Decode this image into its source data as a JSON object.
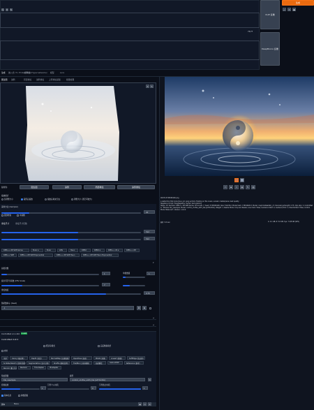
{
  "top": {
    "generate_label": "生成",
    "clip_interrogate_label": "CLIP 反推",
    "deepbooru_label": "DeepBooru 反推",
    "prompt_tokens": "75/75",
    "prompt_text": "",
    "negative_text": ""
  },
  "tabs": {
    "labels": [
      "生成",
      "嵌入式 (T.I. Embedding)",
      "超网络 (Hypernetworks)",
      "模型",
      "Lora"
    ],
    "active_index": 0
  },
  "img2img_tabs": [
    "图生图",
    "涂鸦",
    "局部重绘",
    "涂鸦重绘",
    "上传重绘蒙版",
    "批量处理"
  ],
  "copy_buttons": [
    "复制到:",
    "图生图",
    "涂鸦",
    "局部重绘",
    "涂鸦重绘"
  ],
  "resize_mode": {
    "label": "缩放模式",
    "options": [
      "仅调整大小",
      "裁剪后缩放",
      "缩放后填充空白",
      "调整大小 (潜空间放大)"
    ],
    "selected": 1
  },
  "sampler": {
    "label": "采样方法 (Sampler)",
    "options": [
      "DPM++ 2M SDE Karras",
      "Euler a",
      "Euler",
      "LMS",
      "Heun",
      "DPM2",
      "DPM2 a",
      "DPM++ 2S a",
      "DPM++ 2M",
      "DPM++ SDE",
      "DPM++ 2M SDE Exponential",
      "DPM++ 2M SDE Heun",
      "DPM++ 2M SDE Heun Exponential"
    ],
    "steps_label": "迭代步数 (Steps)",
    "steps": 20
  },
  "options": {
    "restore_faces": "面部修复",
    "tiling": "平铺图",
    "resize_to": "重绘尺寸",
    "resize_by": "重绘尺寸倍数"
  },
  "dims": {
    "width_label": "宽度",
    "width": 512,
    "height_label": "高度",
    "height": 512,
    "batch_count_label": "总批次数",
    "batch_count": 1,
    "batch_size_label": "单批数量",
    "batch_size": 1,
    "cfg_label": "提示词引导系数 (CFG Scale)",
    "cfg": 7,
    "denoise_label": "重绘幅度",
    "denoise": 0.75,
    "seed_label": "随机数种子 (Seed)",
    "seed": "-1"
  },
  "scripts": {
    "script_label": "脚本",
    "script_value": "None"
  },
  "controlnet": {
    "title": "ControlNet v1.1.410",
    "badge": "1 unit",
    "unit_label": "ControlNet Unit 0",
    "enable": "启用",
    "low_vram": "低显存模式",
    "pixel_perfect": "完美像素模式",
    "control_types": [
      "全部",
      "Canny (硬边缘)",
      "Depth (深度)",
      "NormalMap (法线贴图)",
      "OpenPose (姿态)",
      "MLSD (直线)",
      "Lineart (线稿)",
      "SoftEdge (软边缘)",
      "Scribble/Sketch (涂鸦/草图)",
      "Segmentation (语义分割)",
      "Shuffle (随机洗牌)",
      "Tile/Blur (分块/模糊)",
      "局部重绘",
      "InstructP2P",
      "Reference (参考)",
      "Recolor (重上色)",
      "Revision",
      "T2I-Adapter",
      "IP-Adapter"
    ],
    "preprocessor_label": "预处理器",
    "preprocessor": "tile_resample",
    "model_label": "模型",
    "model": "control_v11f1e_sd15_tile [a371b31b]",
    "weight_label": "控制权重",
    "weight": 1,
    "start_label": "引导介入时机",
    "start": 0,
    "end_label": "引导终止时机",
    "end": 1
  },
  "result": {
    "filename": "00135-3746506190.png",
    "prompt_line": "a waterdrop that looks like a yin yang symbol, floating on the ocean, sunset, masterpiece, best quality",
    "negative_line": "Negative prompt: EasyNegative, lowres, bad anatomy",
    "params_line": "Steps: 20, Sampler: DPM++ 2M SDE Karras, CFG scale: 7, Seed: 3746506190, Size: 512x512, Model hash: 7c819b6d13, Model: majicmixRealistic_v7, Denoising strength: 0.75, Clip skip: 2, ControlNet 0: \"Module: tile_resample, Model: control_v11f1e_sd15_tile [a371b31b], Weight: 1, Resize Mode: Crop and Resize, Low Vram: False, Guidance Start: 0, Guidance End: 1, Pixel Perfect: False, Control Mode: Balanced\", Version: v1.6.0",
    "time_label": "耗时: 9.0 sec.",
    "vram_label": "A: 4.1 GB, R: 5.6 GB, Sys: 7.2/8 GB (90%)"
  },
  "action_buttons": [
    "保存",
    "打包下载",
    "发送到 图生图",
    "发送到 局部重绘",
    "发送到 后期处理"
  ],
  "footer_labels": [
    "基本信息",
    "参数面板",
    "Extras 设置"
  ],
  "colors": {
    "bg": "#0b0f19",
    "panel": "#1f2937",
    "accent": "#ea6a10",
    "slider": "#2563eb"
  }
}
